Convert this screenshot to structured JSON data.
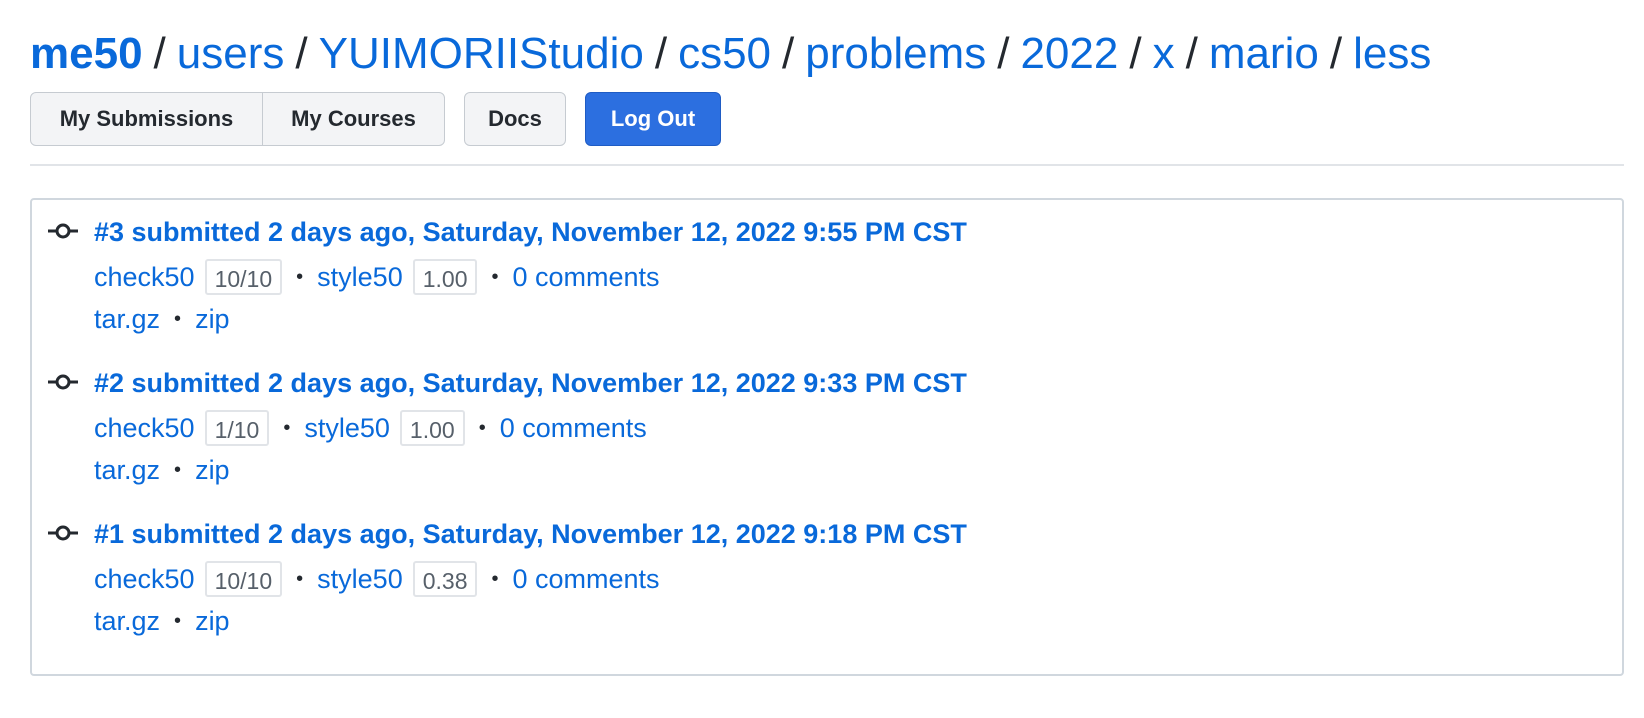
{
  "breadcrumb": [
    "me50",
    "users",
    "YUIMORIIStudio",
    "cs50",
    "problems",
    "2022",
    "x",
    "mario",
    "less"
  ],
  "breadcrumb_separator": "/",
  "toolbar": {
    "submissions_label": "My Submissions",
    "courses_label": "My Courses",
    "docs_label": "Docs",
    "logout_label": "Log Out"
  },
  "submissions": [
    {
      "title": "#3 submitted 2 days ago, Saturday, November 12, 2022 9:55 PM CST",
      "check_label": "check50",
      "check_score": "10/10",
      "style_label": "style50",
      "style_score": "1.00",
      "comments": "0 comments",
      "download_targz": "tar.gz",
      "download_zip": "zip"
    },
    {
      "title": "#2 submitted 2 days ago, Saturday, November 12, 2022 9:33 PM CST",
      "check_label": "check50",
      "check_score": "1/10",
      "style_label": "style50",
      "style_score": "1.00",
      "comments": "0 comments",
      "download_targz": "tar.gz",
      "download_zip": "zip"
    },
    {
      "title": "#1 submitted 2 days ago, Saturday, November 12, 2022 9:18 PM CST",
      "check_label": "check50",
      "check_score": "10/10",
      "style_label": "style50",
      "style_score": "0.38",
      "comments": "0 comments",
      "download_targz": "tar.gz",
      "download_zip": "zip"
    }
  ],
  "bullet": "•",
  "colors": {
    "link": "#0969da",
    "primary_button": "#2c6fe0",
    "text": "#24292f"
  }
}
